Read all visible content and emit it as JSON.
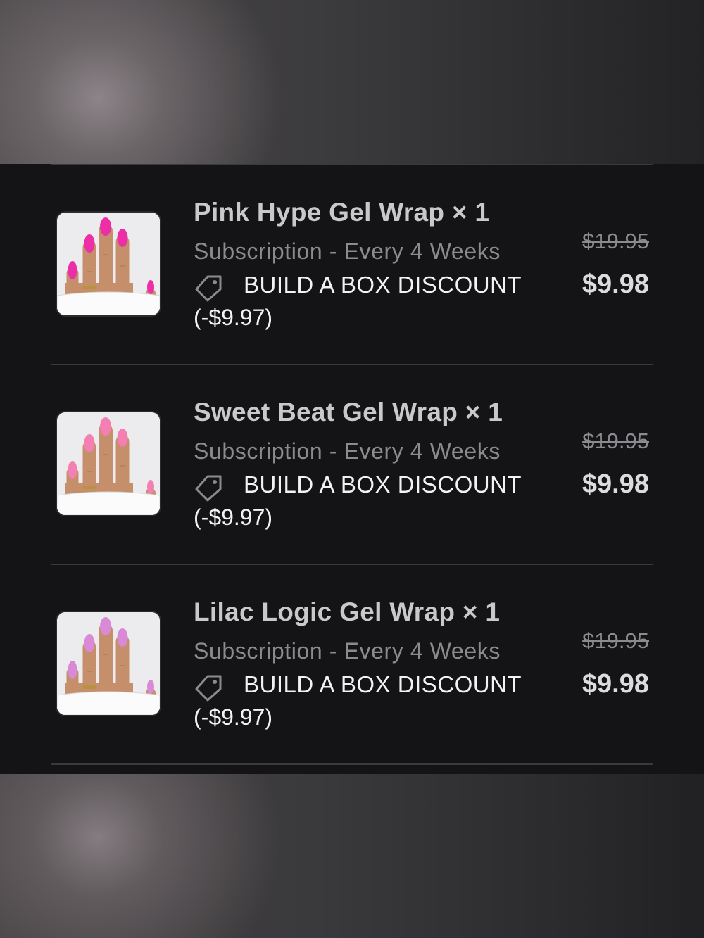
{
  "cart": {
    "items": [
      {
        "title": "Pink Hype Gel Wrap × 1",
        "subtitle": "Subscription - Every 4 Weeks",
        "discount_label": "BUILD A BOX DISCOUNT",
        "discount_amount": "(-$9.97)",
        "original_price": "$19.95",
        "price": "$9.98",
        "nail_color": "#ec2fa6",
        "icon": "tag-icon"
      },
      {
        "title": "Sweet Beat Gel Wrap × 1",
        "subtitle": "Subscription - Every 4 Weeks",
        "discount_label": "BUILD A BOX DISCOUNT",
        "discount_amount": "(-$9.97)",
        "original_price": "$19.95",
        "price": "$9.98",
        "nail_color": "#f37fb3",
        "icon": "tag-icon"
      },
      {
        "title": "Lilac Logic Gel Wrap × 1",
        "subtitle": "Subscription - Every 4 Weeks",
        "discount_label": "BUILD A BOX DISCOUNT",
        "discount_amount": "(-$9.97)",
        "original_price": "$19.95",
        "price": "$9.98",
        "nail_color": "#d98ad6",
        "icon": "tag-icon"
      }
    ]
  },
  "colors": {
    "panel_background": "#141416",
    "divider": "#3a3a3c",
    "title_text": "#c9c9cc",
    "muted_text": "#8b8b8f",
    "bright_text": "#f2f2f4"
  }
}
